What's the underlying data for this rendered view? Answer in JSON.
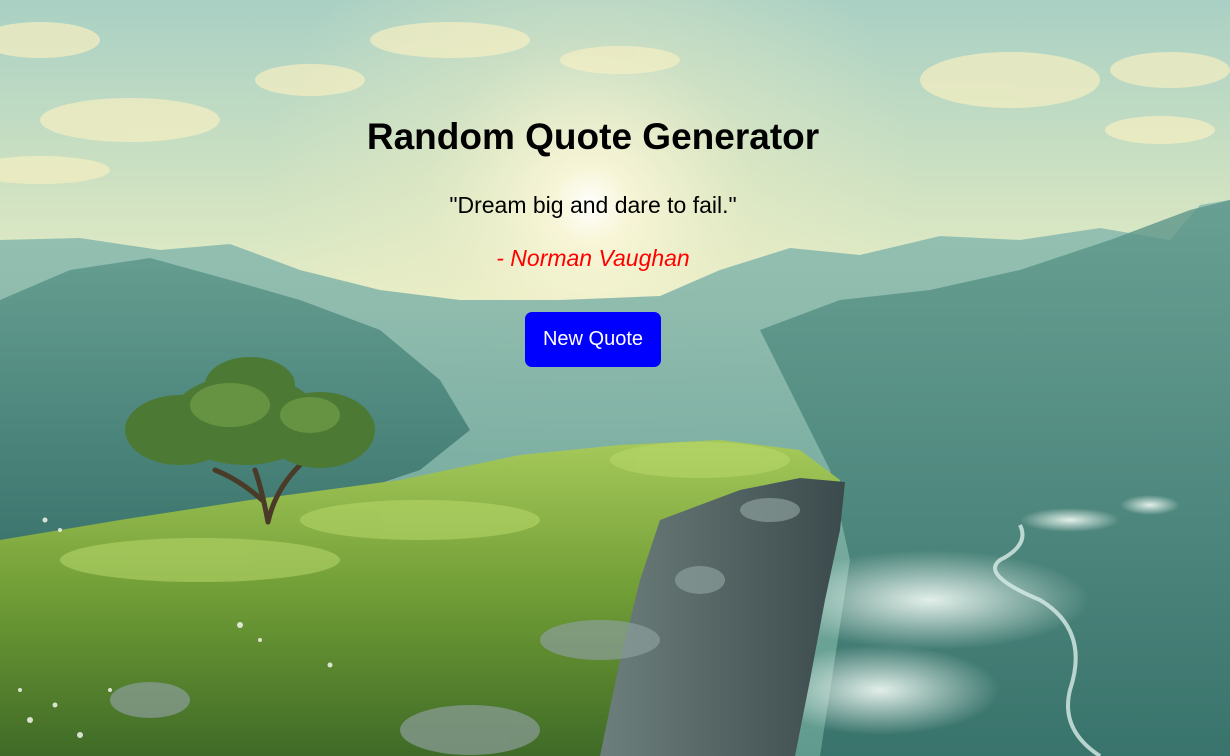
{
  "page": {
    "title": "Random Quote Generator",
    "quote_text": "\"Dream big and dare to fail.\"",
    "quote_author": "- Norman Vaughan",
    "new_quote_label": "New Quote"
  },
  "background": {
    "description_icon": "mountain-cliff-landscape",
    "colors": {
      "sky": "#d9e8c8",
      "mountains": "#6ea79c",
      "grass": "#6b9a3a",
      "rock": "#5d6f70"
    }
  },
  "colors": {
    "title": "#000000",
    "quote": "#000000",
    "author": "#ff0000",
    "button_bg": "#0000ff",
    "button_text": "#ffffff"
  }
}
